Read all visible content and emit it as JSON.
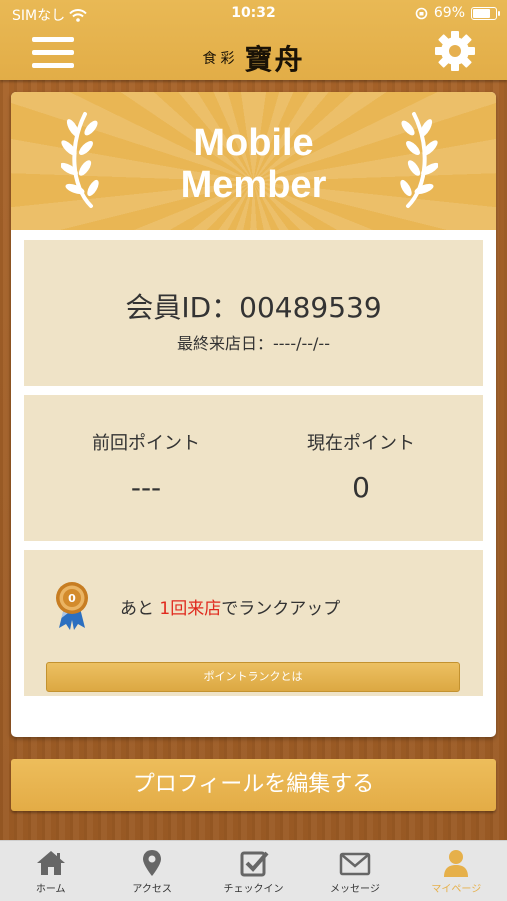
{
  "status_bar": {
    "carrier": "SIMなし",
    "time": "10:32",
    "battery": "69%"
  },
  "header": {
    "logo_small": "食彩",
    "logo_big": "寶舟"
  },
  "banner": {
    "line1": "Mobile",
    "line2": "Member"
  },
  "member": {
    "id_text": "会員ID：00489539",
    "last_visit": "最終来店日：----/--/--"
  },
  "points": {
    "previous_label": "前回ポイント",
    "previous_value": "---",
    "current_label": "現在ポイント",
    "current_value": "0"
  },
  "rank": {
    "prefix": "あと ",
    "highlight": "1回来店",
    "suffix": "でランクアップ",
    "medal_number": "0",
    "button_label": "ポイントランクとは"
  },
  "profile_button": "プロフィールを編集する",
  "tabs": [
    {
      "label": "ホーム",
      "icon": "home-icon"
    },
    {
      "label": "アクセス",
      "icon": "map-pin-icon"
    },
    {
      "label": "チェックイン",
      "icon": "checkin-icon"
    },
    {
      "label": "メッセージ",
      "icon": "envelope-icon"
    },
    {
      "label": "マイページ",
      "icon": "user-icon",
      "active": true
    }
  ],
  "colors": {
    "accent": "#e6b04a",
    "highlight_red": "#e02a1e",
    "panel": "#efe3c7",
    "wood": "#a8642a"
  }
}
